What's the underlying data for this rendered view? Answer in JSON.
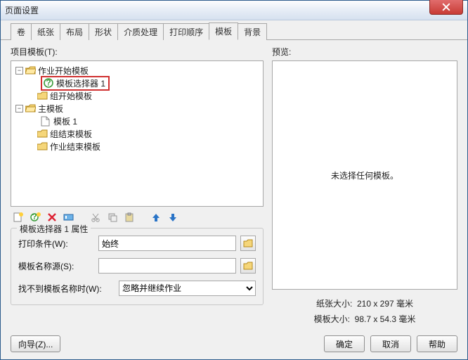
{
  "window": {
    "title": "页面设置"
  },
  "tabs": [
    "卷",
    "纸张",
    "布局",
    "形状",
    "介质处理",
    "打印顺序",
    "模板",
    "背景"
  ],
  "active_tab_index": 6,
  "left": {
    "label": "项目模板(T):",
    "tree": {
      "job_start": "作业开始模板",
      "selector1": "模板选择器 1",
      "group_start": "组开始模板",
      "main": "主模板",
      "template1": "模板 1",
      "group_end": "组结束模板",
      "job_end": "作业结束模板"
    },
    "props": {
      "legend": "模板选择器 1 属性",
      "print_cond_label": "打印条件(W):",
      "print_cond_value": "始终",
      "name_src_label": "模板名称源(S):",
      "name_src_value": "",
      "notfound_label": "找不到模板名称时(W):",
      "notfound_value": "忽略并继续作业"
    }
  },
  "right": {
    "label": "预览:",
    "placeholder": "未选择任何模板。",
    "paper_label": "纸张大小:",
    "paper_value": "210 x 297 毫米",
    "tmpl_label": "模板大小:",
    "tmpl_value": "98.7 x 54.3 毫米"
  },
  "footer": {
    "wizard": "向导(Z)...",
    "ok": "确定",
    "cancel": "取消",
    "help": "帮助"
  },
  "icons": {
    "new_tmpl": "new-template-icon",
    "new_sel": "new-selector-icon",
    "delete": "delete-icon",
    "rename": "rename-icon",
    "cut": "cut-icon",
    "copy": "copy-icon",
    "paste": "paste-icon",
    "up": "move-up-icon",
    "down": "move-down-icon"
  }
}
